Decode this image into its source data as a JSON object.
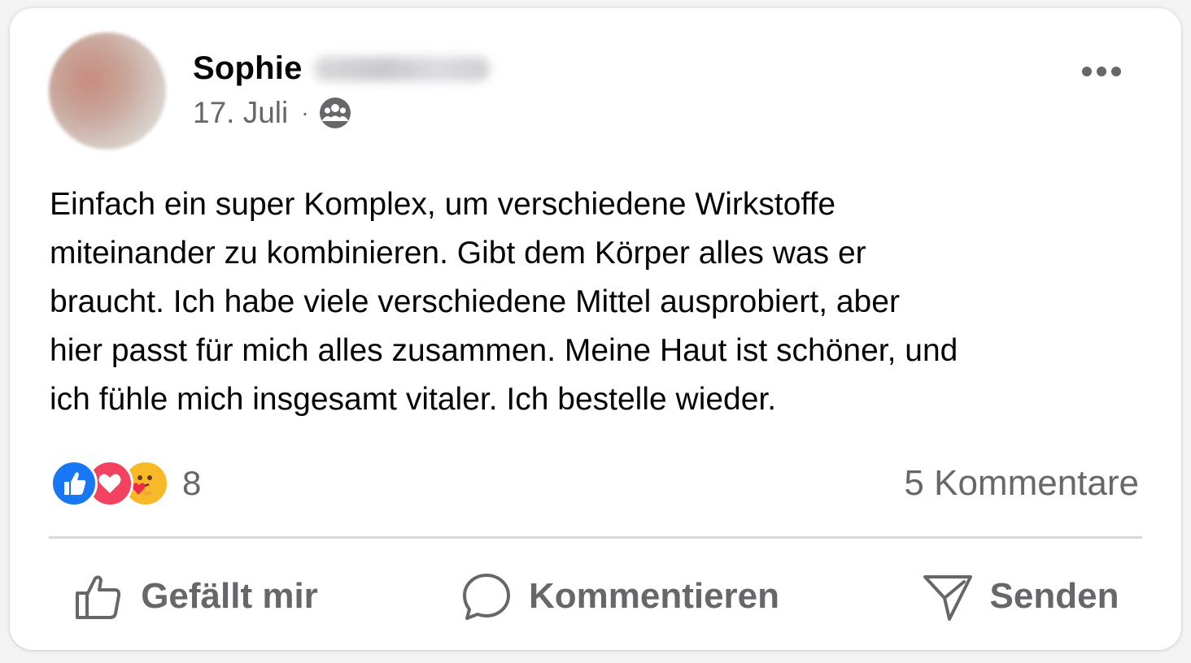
{
  "post": {
    "author_first": "Sophie",
    "date": "17. Juli",
    "separator": "·",
    "audience_icon": "friends-icon",
    "more_icon": "more-dots-icon",
    "text_lines": [
      "Einfach ein super Komplex, um verschiedene Wirkstoffe",
      "miteinander zu kombinieren. Gibt dem Körper alles was er",
      "braucht. Ich habe viele verschiedene Mittel ausprobiert, aber",
      "hier passt für mich alles zusammen. Meine Haut ist schöner, und",
      "ich fühle mich insgesamt vitaler. Ich bestelle wieder."
    ]
  },
  "reactions": {
    "icons": [
      "like-reaction-icon",
      "love-reaction-icon",
      "care-reaction-icon"
    ],
    "count": "8"
  },
  "comments": {
    "label": "5 Kommentare"
  },
  "actions": {
    "like": {
      "label": "Gefällt mir",
      "icon": "thumbs-up-icon"
    },
    "comment": {
      "label": "Kommentieren",
      "icon": "comment-bubble-icon"
    },
    "send": {
      "label": "Senden",
      "icon": "send-icon"
    }
  },
  "colors": {
    "text_primary": "#050505",
    "text_secondary": "#65676b",
    "like_blue": "#1877f2",
    "love_red": "#f3425f",
    "care_yellow": "#f7b928",
    "divider": "#d9dadc"
  }
}
